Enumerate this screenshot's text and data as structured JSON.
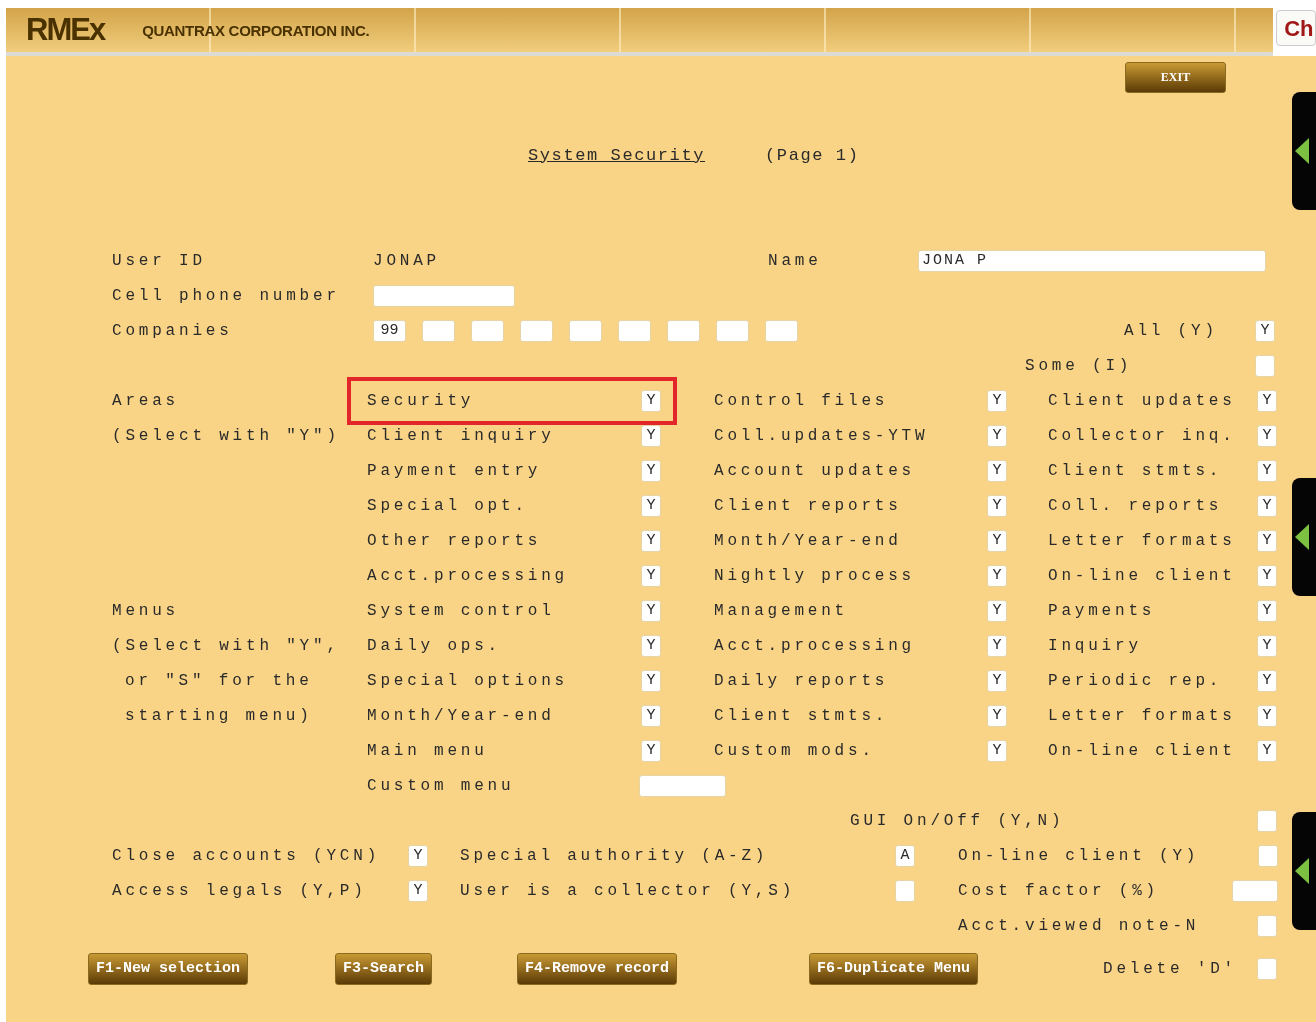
{
  "header": {
    "logo": "RMEx",
    "company": "QUANTRAX CORPORATION INC.",
    "corner_button": "Ch"
  },
  "exit_button": "EXIT",
  "title": {
    "text": "System Security",
    "page": "(Page 1)"
  },
  "user": {
    "label": "User ID",
    "value": "JONAP",
    "name_label": "Name",
    "name_value": "JONA P"
  },
  "cell_phone": {
    "label": "Cell phone number"
  },
  "companies": {
    "label": "Companies",
    "fields": [
      {
        "kind": "filled",
        "value": "99"
      },
      {
        "kind": "blank"
      },
      {
        "kind": "blank"
      },
      {
        "kind": "blank"
      },
      {
        "kind": "blank"
      },
      {
        "kind": "blank"
      },
      {
        "kind": "blank"
      },
      {
        "kind": "blank"
      },
      {
        "kind": "blank"
      }
    ]
  },
  "all": {
    "label": "All (Y)",
    "value": "Y"
  },
  "some": {
    "label": "Some (I)"
  },
  "areas": {
    "label": "Areas",
    "note": "(Select with \"Y\")",
    "items": [
      {
        "label": "Security",
        "value": "Y",
        "highlighted": true
      },
      {
        "label": "Control files",
        "value": "Y",
        "highlighted": false
      },
      {
        "label": "Client updates",
        "value": "Y",
        "highlighted": false
      },
      {
        "label": "Client inquiry",
        "value": "Y",
        "highlighted": false
      },
      {
        "label": "Coll.updates-YTW",
        "value": "Y",
        "highlighted": false
      },
      {
        "label": "Collector inq.",
        "value": "Y",
        "highlighted": false
      },
      {
        "label": "Payment entry",
        "value": "Y",
        "highlighted": false
      },
      {
        "label": "Account updates",
        "value": "Y",
        "highlighted": false
      },
      {
        "label": "Client stmts.",
        "value": "Y",
        "highlighted": false
      },
      {
        "label": "Special opt.",
        "value": "Y",
        "highlighted": false
      },
      {
        "label": "Client reports",
        "value": "Y",
        "highlighted": false
      },
      {
        "label": "Coll. reports",
        "value": "Y",
        "highlighted": false
      },
      {
        "label": "Other reports",
        "value": "Y",
        "highlighted": false
      },
      {
        "label": "Month/Year-end",
        "value": "Y",
        "highlighted": false
      },
      {
        "label": "Letter formats",
        "value": "Y",
        "highlighted": false
      },
      {
        "label": "Acct.processing",
        "value": "Y",
        "highlighted": false
      },
      {
        "label": "Nightly process",
        "value": "Y",
        "highlighted": false
      },
      {
        "label": "On-line client",
        "value": "Y",
        "highlighted": false
      }
    ]
  },
  "menus": {
    "label": "Menus",
    "note_lines": [
      "(Select with \"Y\",",
      "or \"S\" for the",
      "starting menu)"
    ],
    "items": [
      {
        "label": "System control",
        "value": "Y"
      },
      {
        "label": "Management",
        "value": "Y"
      },
      {
        "label": "Payments",
        "value": "Y"
      },
      {
        "label": "Daily ops.",
        "value": "Y"
      },
      {
        "label": "Acct.processing",
        "value": "Y"
      },
      {
        "label": "Inquiry",
        "value": "Y"
      },
      {
        "label": "Special options",
        "value": "Y"
      },
      {
        "label": "Daily reports",
        "value": "Y"
      },
      {
        "label": "Periodic rep.",
        "value": "Y"
      },
      {
        "label": "Month/Year-end",
        "value": "Y"
      },
      {
        "label": "Client stmts.",
        "value": "Y"
      },
      {
        "label": "Letter formats",
        "value": "Y"
      },
      {
        "label": "Main menu",
        "value": "Y"
      },
      {
        "label": "Custom mods.",
        "value": "Y"
      },
      {
        "label": "On-line client",
        "value": "Y"
      }
    ],
    "custom_menu": {
      "label": "Custom menu"
    }
  },
  "gui": {
    "label": "GUI On/Off (Y,N)"
  },
  "close_accounts": {
    "label": "Close accounts (YCN)",
    "value": "Y"
  },
  "special_authority": {
    "label": "Special authority (A-Z)",
    "value": "A"
  },
  "online_client": {
    "label": "On-line client (Y)"
  },
  "access_legals": {
    "label": "Access legals (Y,P)",
    "value": "Y"
  },
  "collector": {
    "label": "User is a collector (Y,S)"
  },
  "cost_factor": {
    "label": "Cost factor (%)"
  },
  "acct_viewed": {
    "label": "Acct.viewed note-N"
  },
  "delete": {
    "label": "Delete 'D'"
  },
  "buttons": [
    "F1-New selection",
    "F3-Search",
    "F4-Remove record",
    "F6-Duplicate Menu"
  ]
}
